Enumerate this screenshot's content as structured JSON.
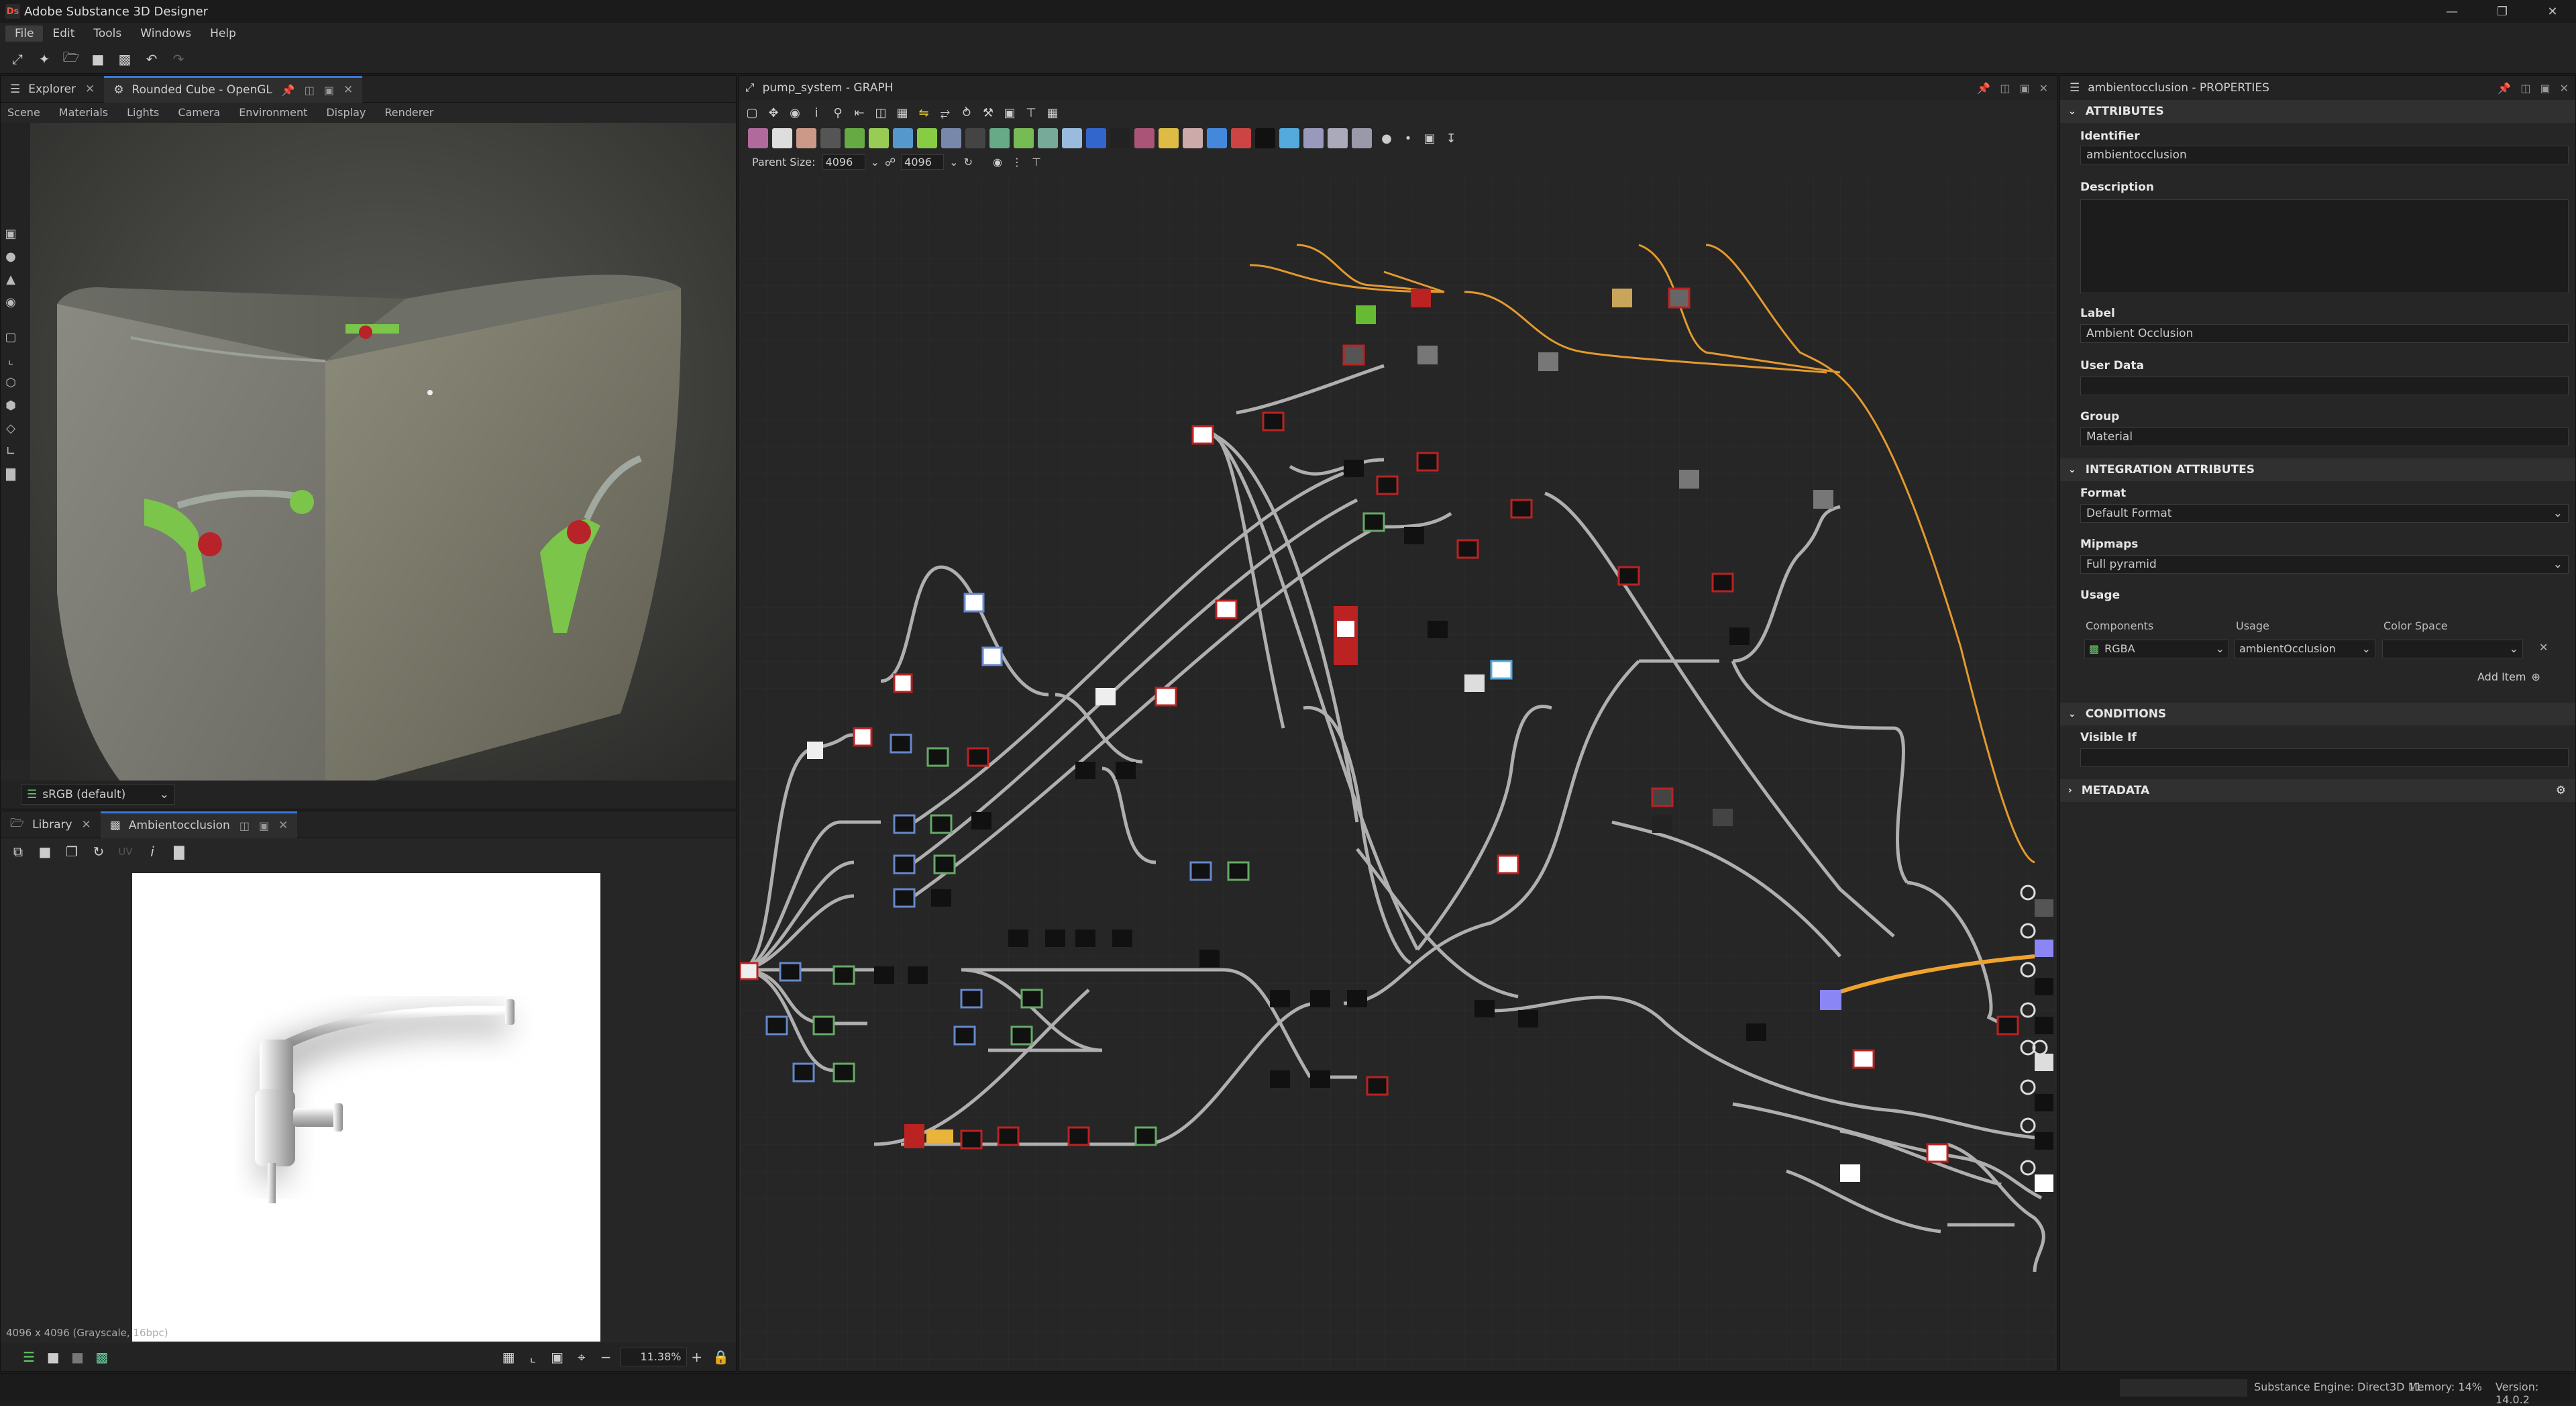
{
  "window": {
    "title": "Adobe Substance 3D Designer",
    "app_icon": "Ds"
  },
  "menu": [
    "File",
    "Edit",
    "Tools",
    "Windows",
    "Help"
  ],
  "viewport3d": {
    "tabs": [
      {
        "label": "Explorer"
      },
      {
        "label": "Rounded Cube - OpenGL"
      }
    ],
    "subtabs": [
      "Scene",
      "Materials",
      "Lights",
      "Camera",
      "Environment",
      "Display",
      "Renderer"
    ],
    "colorspace": "sRGB (default)"
  },
  "viewer2d": {
    "tabs": [
      {
        "label": "Library"
      },
      {
        "label": "Ambientocclusion"
      }
    ],
    "uv_label": "UV",
    "info": "4096 x 4096 (Grayscale, 16bpc)",
    "zoom": "11.38%"
  },
  "graph": {
    "title": "pump_system - GRAPH",
    "parent_size_label": "Parent Size:",
    "parent_size": "4096",
    "size2": "4096"
  },
  "properties": {
    "title": "ambientocclusion - PROPERTIES",
    "sections": {
      "attributes": "ATTRIBUTES",
      "integration": "INTEGRATION ATTRIBUTES",
      "conditions": "CONDITIONS",
      "metadata": "METADATA"
    },
    "identifier_label": "Identifier",
    "identifier": "ambientocclusion",
    "description_label": "Description",
    "description": "",
    "label_label": "Label",
    "label": "Ambient Occlusion",
    "userdata_label": "User Data",
    "userdata": "",
    "group_label": "Group",
    "group": "Material",
    "format_label": "Format",
    "format": "Default Format",
    "mipmaps_label": "Mipmaps",
    "mipmaps": "Full pyramid",
    "usage_label": "Usage",
    "usage_headers": [
      "Components",
      "Usage",
      "Color Space"
    ],
    "usage_row": {
      "components": "RGBA",
      "usage": "ambientOcclusion",
      "colorspace": ""
    },
    "add_item": "Add Item",
    "visible_if_label": "Visible If",
    "visible_if": ""
  },
  "status": {
    "engine": "Substance Engine: Direct3D 11",
    "memory": "Memory: 14%",
    "version": "Version: 14.0.2"
  }
}
